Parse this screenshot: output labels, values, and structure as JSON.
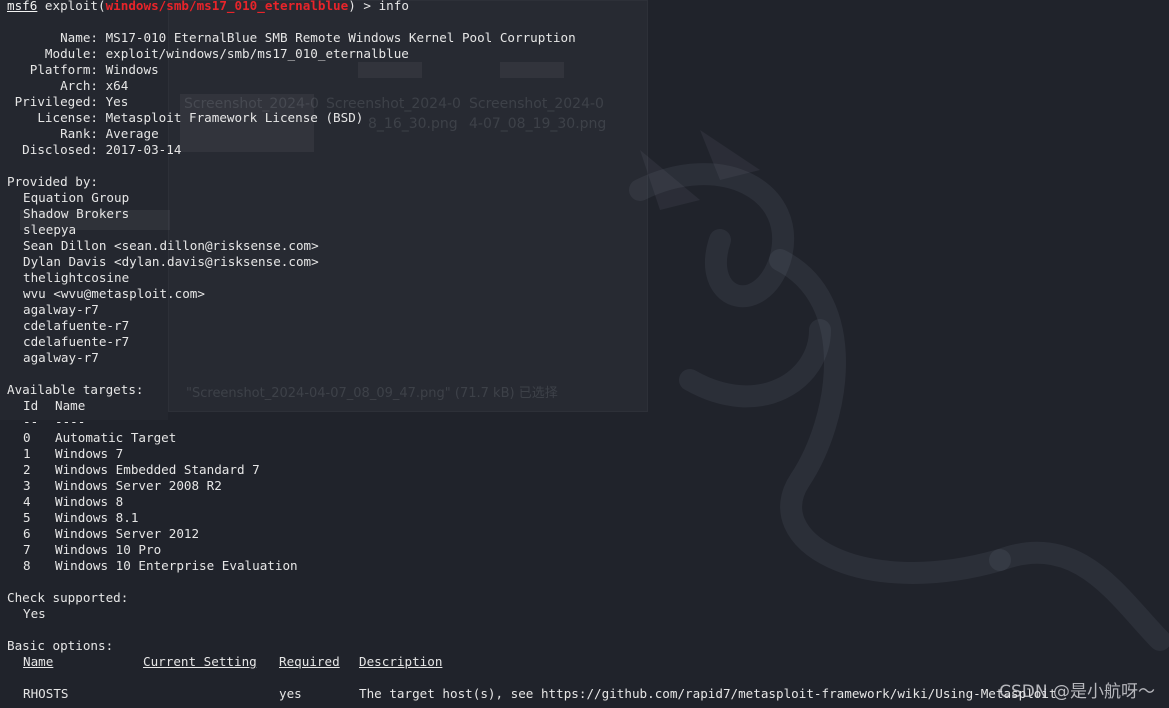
{
  "prompt": {
    "msf": "msf6",
    "module_path": "windows/smb/ms17_010_eternalblue",
    "command": "info",
    "prefix": " exploit(",
    "suffix": ") > "
  },
  "info_fields": [
    {
      "label": "       Name:",
      "value": " MS17-010 EternalBlue SMB Remote Windows Kernel Pool Corruption"
    },
    {
      "label": "     Module:",
      "value": " exploit/windows/smb/ms17_010_eternalblue"
    },
    {
      "label": "   Platform:",
      "value": " Windows"
    },
    {
      "label": "       Arch:",
      "value": " x64"
    },
    {
      "label": " Privileged:",
      "value": " Yes"
    },
    {
      "label": "    License:",
      "value": " Metasploit Framework License (BSD)"
    },
    {
      "label": "       Rank:",
      "value": " Average"
    },
    {
      "label": "  Disclosed:",
      "value": " 2017-03-14"
    }
  ],
  "provided_by": {
    "heading": "Provided by:",
    "authors": [
      "Equation Group",
      "Shadow Brokers",
      "sleepya",
      "Sean Dillon <sean.dillon@risksense.com>",
      "Dylan Davis <dylan.davis@risksense.com>",
      "thelightcosine",
      "wvu <wvu@metasploit.com>",
      "agalway-r7",
      "cdelafuente-r7",
      "cdelafuente-r7",
      "agalway-r7"
    ]
  },
  "targets": {
    "heading": "Available targets:",
    "col_id": "Id",
    "col_name": "Name",
    "id_rule": "--",
    "name_rule": "----",
    "rows": [
      {
        "id": "0",
        "name": "Automatic Target"
      },
      {
        "id": "1",
        "name": "Windows 7"
      },
      {
        "id": "2",
        "name": "Windows Embedded Standard 7"
      },
      {
        "id": "3",
        "name": "Windows Server 2008 R2"
      },
      {
        "id": "4",
        "name": "Windows 8"
      },
      {
        "id": "5",
        "name": "Windows 8.1"
      },
      {
        "id": "6",
        "name": "Windows Server 2012"
      },
      {
        "id": "7",
        "name": "Windows 10 Pro"
      },
      {
        "id": "8",
        "name": "Windows 10 Enterprise Evaluation"
      }
    ]
  },
  "check": {
    "heading": "Check supported:",
    "value": "Yes"
  },
  "options": {
    "heading": "Basic options:",
    "columns": [
      "Name",
      "Current Setting",
      "Required",
      "Description"
    ],
    "rows": [
      {
        "name": "RHOSTS",
        "current": "",
        "required": "yes",
        "description": "The target host(s), see https://github.com/rapid7/metasploit-framework/wiki/Using-Metasploit"
      }
    ]
  },
  "background": {
    "ghost_label_1": "Screenshot_2024-0",
    "ghost_label_2": "Screenshot_2024-0",
    "ghost_label_3": "Screenshot_2024-0",
    "ghost_sub_1": "8_16_30.png",
    "ghost_sub_2": "4-07_08_19_30.png",
    "ghost_status": "\"Screenshot_2024-04-07_08_09_47.png\" (71.7 kB) 已选择"
  },
  "watermark": "CSDN @是小航呀～",
  "colors": {
    "background": "#20232b",
    "text": "#e6e6e6",
    "module_accent": "#e8242a"
  }
}
